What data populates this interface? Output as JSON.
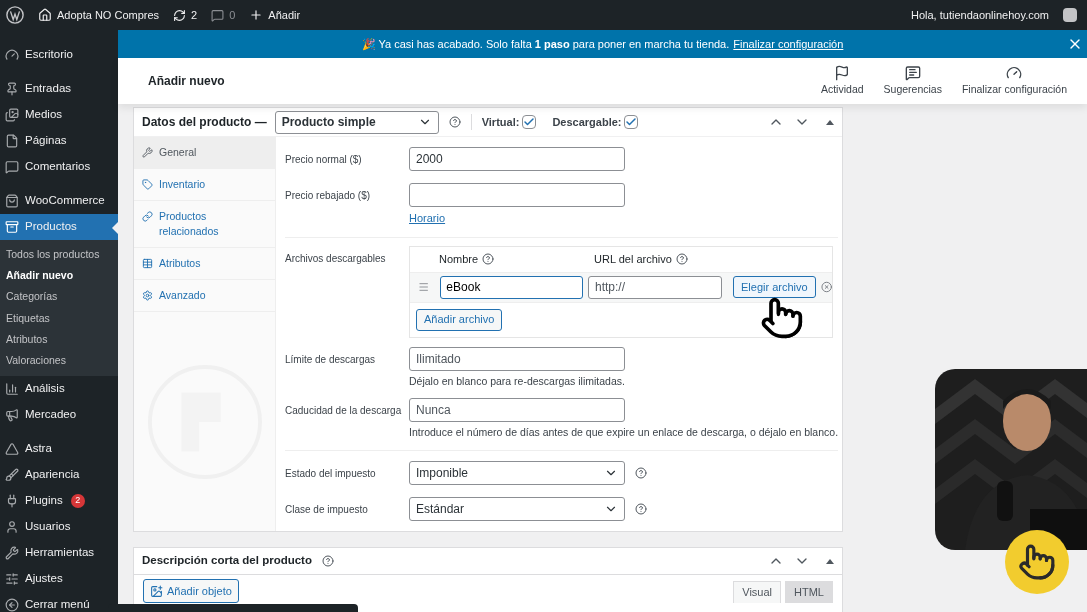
{
  "admin_bar": {
    "site": "Adopta NO Compres",
    "updates": "2",
    "comments": "0",
    "new": "Añadir",
    "greeting": "Hola, tutiendaonlinehoy.com"
  },
  "sidebar": {
    "groups": [
      {
        "items": [
          {
            "label": "Escritorio",
            "selected": false
          }
        ]
      },
      {
        "items": [
          {
            "label": "Entradas",
            "selected": false
          },
          {
            "label": "Medios",
            "selected": false
          },
          {
            "label": "Páginas",
            "selected": false
          },
          {
            "label": "Comentarios",
            "selected": false
          }
        ]
      },
      {
        "items": [
          {
            "label": "WooCommerce",
            "selected": false
          },
          {
            "label": "Productos",
            "selected": true,
            "children": [
              {
                "label": "Todos los productos",
                "selected": false
              },
              {
                "label": "Añadir nuevo",
                "selected": true
              },
              {
                "label": "Categorías",
                "selected": false
              },
              {
                "label": "Etiquetas",
                "selected": false
              },
              {
                "label": "Atributos",
                "selected": false
              },
              {
                "label": "Valoraciones",
                "selected": false
              }
            ]
          },
          {
            "label": "Análisis",
            "selected": false
          },
          {
            "label": "Mercadeo",
            "selected": false
          }
        ]
      },
      {
        "items": [
          {
            "label": "Astra",
            "selected": false
          },
          {
            "label": "Apariencia",
            "selected": false
          },
          {
            "label": "Plugins",
            "selected": false,
            "badge": "2"
          },
          {
            "label": "Usuarios",
            "selected": false
          },
          {
            "label": "Herramientas",
            "selected": false
          },
          {
            "label": "Ajustes",
            "selected": false
          },
          {
            "label": "Cerrar menú",
            "selected": false
          }
        ]
      }
    ]
  },
  "notice": {
    "text": "🎉 Ya casi has acabado. Solo falta **1 paso** para poner en marcha tu tienda.",
    "link": "Finalizar configuración"
  },
  "header": {
    "title": "Añadir nuevo",
    "actions": [
      "Actividad",
      "Sugerencias",
      "Finalizar configuración"
    ]
  },
  "product_data": {
    "title": "Datos del producto —",
    "type": "Producto simple",
    "virtual": {
      "label": "Virtual:",
      "checked": true
    },
    "downloadable": {
      "label": "Descargable:",
      "checked": true
    },
    "tabs": [
      {
        "label": "General",
        "selected": true
      },
      {
        "label": "Inventario",
        "selected": false
      },
      {
        "label": "Productos relacionados",
        "selected": false
      },
      {
        "label": "Atributos",
        "selected": false
      },
      {
        "label": "Avanzado",
        "selected": false
      }
    ],
    "regular_price": {
      "label": "Precio normal ($)",
      "value": "2000"
    },
    "sale_price": {
      "label": "Precio rebajado ($)",
      "link": "Horario"
    },
    "downloads": {
      "label": "Archivos descargables",
      "columns": [
        "Nombre",
        "URL del archivo"
      ],
      "rows": [
        {
          "name": "eBook",
          "url_placeholder": "http://",
          "choose": "Elegir archivo"
        }
      ],
      "add": "Añadir archivo"
    },
    "limit": {
      "label": "Límite de descargas",
      "placeholder": "Ilimitado",
      "hint": "Déjalo en blanco para re-descargas ilimitadas."
    },
    "expiry": {
      "label": "Caducidad de la descarga",
      "placeholder": "Nunca",
      "hint": "Introduce el número de días antes de que expire un enlace de descarga, o déjalo en blanco."
    },
    "tax_status": {
      "label": "Estado del impuesto",
      "value": "Imponible"
    },
    "tax_class": {
      "label": "Clase de impuesto",
      "value": "Estándar"
    }
  },
  "short_description": {
    "title": "Descripción corta del producto",
    "add_media": "Añadir objeto",
    "tabs": [
      {
        "label": "Visual",
        "selected": true
      },
      {
        "label": "HTML",
        "selected": false
      }
    ]
  }
}
